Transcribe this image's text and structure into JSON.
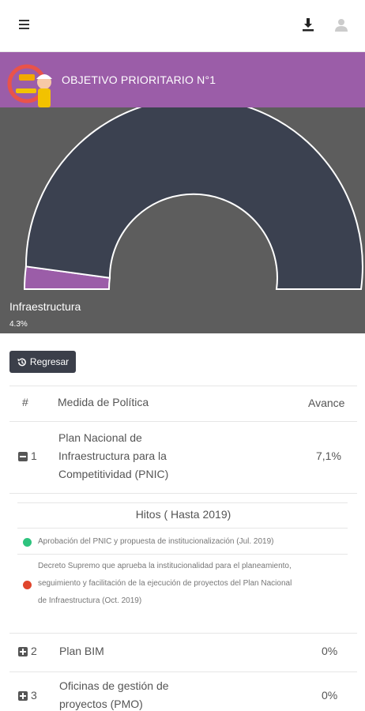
{
  "header": {
    "menu_icon": "hamburger-icon",
    "download_icon": "download-icon",
    "user_icon": "user-icon"
  },
  "banner": {
    "title": "OBJETIVO PRIORITARIO N°1",
    "color": "#9b5da8",
    "logo_icon": "engineer-logo"
  },
  "chart_data": {
    "type": "pie",
    "title": "",
    "categories": [
      "Infraestructura",
      ""
    ],
    "values": [
      4.3,
      95.7
    ],
    "colors": [
      "#9b5da8",
      "#3b4150"
    ],
    "background": "#5d5d5d",
    "semicircle": true,
    "label": "Infraestructura",
    "value_label": "4.3%"
  },
  "back_button": {
    "label": "Regresar",
    "icon": "history-icon"
  },
  "table": {
    "headers": [
      "#",
      "Medida de Política",
      "Avance"
    ],
    "rows": [
      {
        "num": "1",
        "name_lines": [
          "Plan Nacional de",
          "Infraestructura para la",
          "Competitividad (PNIC)"
        ],
        "avance": "7,1%",
        "expanded": true
      },
      {
        "num": "2",
        "name_lines": [
          "Plan BIM"
        ],
        "avance": "0%",
        "expanded": false
      },
      {
        "num": "3",
        "name_lines": [
          "Oficinas de gestión de",
          "proyectos (PMO)"
        ],
        "avance": "0%",
        "expanded": false
      }
    ]
  },
  "hitos": {
    "title": "Hitos ( Hasta 2019)",
    "items": [
      {
        "status_color": "#2ec37e",
        "lines": [
          "Aprobación del PNIC y propuesta de institucionalización (Jul. 2019)"
        ]
      },
      {
        "status_color": "#e0452c",
        "lines": [
          "Decreto Supremo que aprueba la institucionalidad para el planeamiento,",
          "seguimiento y facilitación de la ejecución de proyectos del Plan Nacional",
          "de Infraestructura (Oct. 2019)"
        ]
      }
    ]
  }
}
